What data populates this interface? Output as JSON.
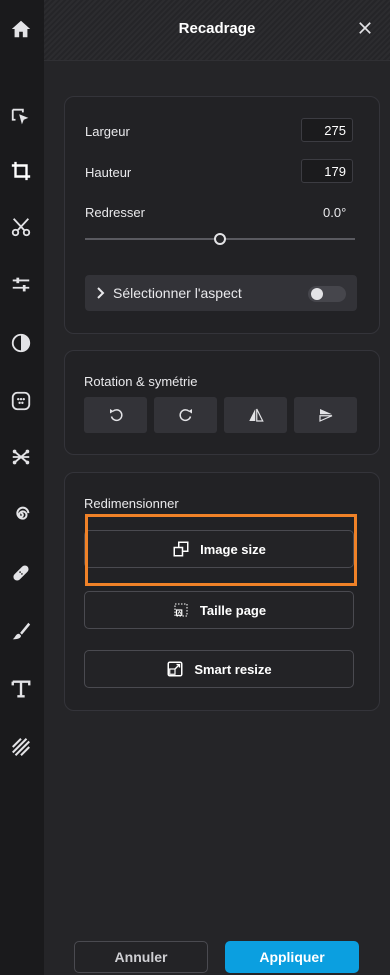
{
  "header": {
    "title": "Recadrage"
  },
  "sidebar": {
    "items": [
      {
        "name": "home",
        "icon": "home-icon"
      },
      {
        "name": "select",
        "icon": "select-cursor-icon"
      },
      {
        "name": "crop",
        "icon": "crop-icon",
        "active": true
      },
      {
        "name": "cut",
        "icon": "scissors-icon"
      },
      {
        "name": "adjust",
        "icon": "sliders-icon"
      },
      {
        "name": "contrast",
        "icon": "contrast-icon"
      },
      {
        "name": "filters",
        "icon": "filter-icon"
      },
      {
        "name": "effects",
        "icon": "effects-icon"
      },
      {
        "name": "distort",
        "icon": "spiral-icon"
      },
      {
        "name": "retouch",
        "icon": "bandage-icon"
      },
      {
        "name": "brush",
        "icon": "brush-icon"
      },
      {
        "name": "text",
        "icon": "text-icon"
      },
      {
        "name": "texture",
        "icon": "texture-icon"
      }
    ]
  },
  "crop": {
    "width_label": "Largeur",
    "width_value": "275",
    "height_label": "Hauteur",
    "height_value": "179",
    "straighten_label": "Redresser",
    "straighten_value": "0.0°",
    "straighten_level": 0.5,
    "aspect_label": "Sélectionner l'aspect",
    "aspect_toggle_on": false
  },
  "rotation": {
    "title": "Rotation & symétrie",
    "buttons": [
      "rotate-left-icon",
      "rotate-right-icon",
      "flip-horizontal-icon",
      "flip-vertical-icon"
    ]
  },
  "resize": {
    "title": "Redimensionner",
    "image_size_label": "Image size",
    "page_size_label": "Taille page",
    "smart_resize_label": "Smart resize"
  },
  "footer": {
    "cancel_label": "Annuler",
    "apply_label": "Appliquer"
  },
  "colors": {
    "accent": "#0b9fe0",
    "highlight": "#f08228",
    "panel": "#252528"
  }
}
